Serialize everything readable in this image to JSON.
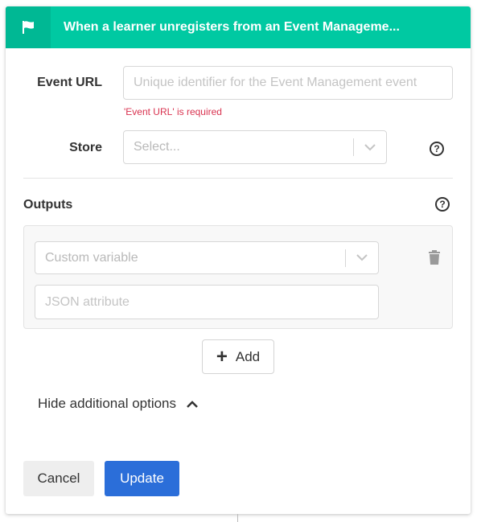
{
  "header": {
    "title": "When a learner unregisters from an Event Manageme...",
    "icon": "flag-icon",
    "color": "#00c9a2"
  },
  "form": {
    "event_url": {
      "label": "Event URL",
      "placeholder": "Unique identifier for the Event Management event",
      "value": "",
      "error": "'Event URL' is required"
    },
    "store": {
      "label": "Store",
      "placeholder": "Select...",
      "help_icon": "question-circle-icon"
    }
  },
  "outputs": {
    "label": "Outputs",
    "help_icon": "question-circle-icon",
    "rows": [
      {
        "variable_placeholder": "Custom variable",
        "attribute_placeholder": "JSON attribute",
        "delete_icon": "trash-icon"
      }
    ],
    "add_label": "Add"
  },
  "options_toggle": {
    "label": "Hide additional options",
    "icon": "chevron-up-icon"
  },
  "actions": {
    "cancel_label": "Cancel",
    "update_label": "Update",
    "primary_color": "#2b6ed9"
  }
}
